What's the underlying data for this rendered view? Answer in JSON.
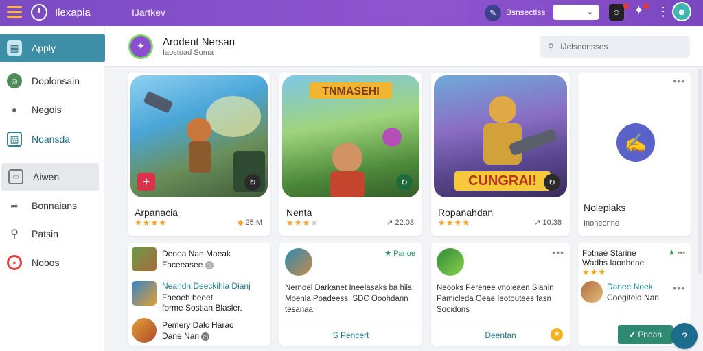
{
  "topbar": {
    "brand": "Ilexapia",
    "nav": "IJartkev",
    "account_text": "Bsnsectlss",
    "select_value": "",
    "more": "⋮",
    "bell": "✦"
  },
  "sidebar": {
    "items": [
      {
        "label": "Apply",
        "icon": "grid-icon"
      },
      {
        "label": "Doplonsain",
        "icon": "avatar-icon"
      },
      {
        "label": "Negois",
        "icon": "person-icon"
      },
      {
        "label": "Noansda",
        "icon": "image-icon"
      },
      {
        "label": "Aiwen",
        "icon": "card-icon"
      },
      {
        "label": "Bonnaians",
        "icon": "share-icon"
      },
      {
        "label": "Patsin",
        "icon": "search-icon"
      },
      {
        "label": "Nobos",
        "icon": "circle-icon"
      }
    ]
  },
  "header": {
    "title": "Arodent Nersan",
    "subtitle": "Iaostoad  Soma",
    "search_placeholder": "IJelseonsses"
  },
  "cards": [
    {
      "title": "Arpanacia",
      "meta": "25.M"
    },
    {
      "title": "Nenta",
      "meta": "22.03"
    },
    {
      "title": "Ropanahdan",
      "meta": "10.38"
    },
    {
      "title": "Nolepiaks",
      "meta": "Inoneonne"
    }
  ],
  "images": {
    "card2_banner": "TNMASEHI",
    "card3_banner": "CUNGRAI!"
  },
  "list_cards": {
    "card1": {
      "title": "Denea Nan Maeak",
      "sub": "Faceeasee",
      "row2_title": "Neandn Deeckihia Dianj",
      "row2_line1": "Faeoeh beeet",
      "row2_line2": "forme Sostian  Blasler.",
      "row3_title": "Pemery Dalc Harac",
      "row3_sub": "Dane  Nan"
    },
    "card2": {
      "badge": "Panoe",
      "body": "Nernoel Darkanet Ineelasaks ba hiis. Moenla Poadeess. SDC Ooohdarin tesanaa.",
      "button": "S Pencert"
    },
    "card3": {
      "body": "Neooks Perenee vnoleaen Slanin Pamicleda Oeae Ieotoutees fasn Sooidons",
      "button": "Deentan"
    },
    "card4": {
      "title": "Fotnae Starine",
      "sub": "Wadhs  Iaonbeae",
      "row_title": "Danee Noek",
      "row_sub": "Coogiteid Nan",
      "button": "Pnean"
    }
  },
  "colors": {
    "accent": "#8b53cd",
    "teal": "#3d8fa8",
    "star": "#f0a51a"
  }
}
